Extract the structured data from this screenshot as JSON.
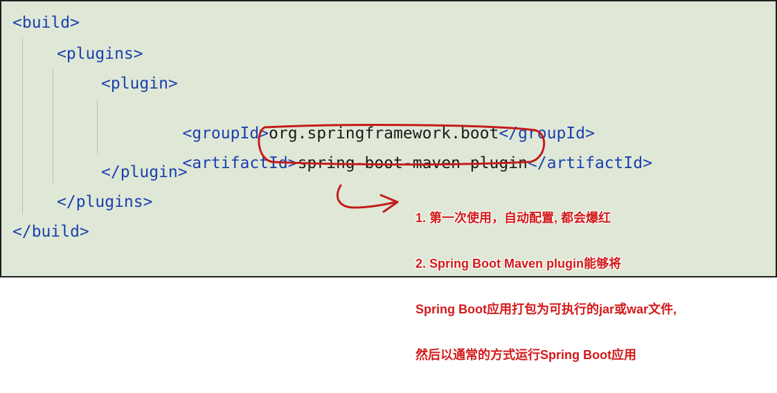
{
  "code": {
    "build_open": "<build>",
    "plugins_open": "<plugins>",
    "plugin_open": "<plugin>",
    "group_open": "<groupId>",
    "group_value": "org.springframework.boot",
    "group_close": "</groupId>",
    "artifact_open": "<artifactId>",
    "artifact_value": "spring-boot-maven-plugin",
    "artifact_close": "</artifactId>",
    "plugin_close": "</plugin>",
    "plugins_close": "</plugins>",
    "build_close": "</build>"
  },
  "annotation": {
    "line1": "1. 第一次使用，自动配置, 都会爆红",
    "line2": "2. Spring Boot Maven plugin能够将",
    "line3": "Spring Boot应用打包为可执行的jar或war文件,",
    "line4": "然后以通常的方式运行Spring Boot应用",
    "color": "#d21a1a"
  }
}
